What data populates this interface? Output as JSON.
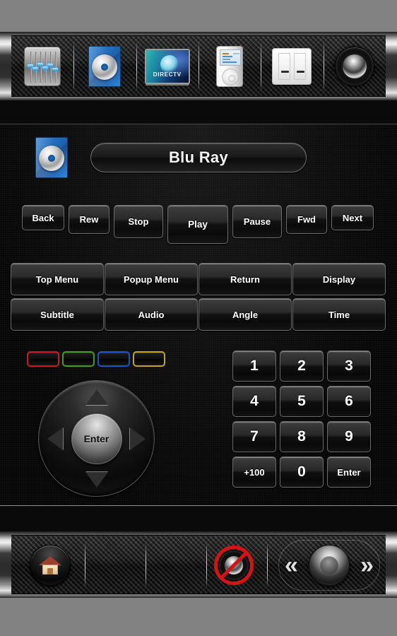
{
  "app": {
    "title": "Blu Ray",
    "background_color": "#828282"
  },
  "tabbar": {
    "items": [
      {
        "label": "Receiver",
        "icon": "equalizer-icon"
      },
      {
        "label": "Blu Ray",
        "icon": "bluray-disc-icon",
        "selected": true
      },
      {
        "label": "DIRECTV",
        "icon": "directv-tv-icon",
        "screen_text": "DIRECTV"
      },
      {
        "label": "iPod",
        "icon": "ipod-icon"
      },
      {
        "label": "Lights",
        "icon": "light-switch-icon"
      },
      {
        "label": "Speakers",
        "icon": "speaker-icon"
      }
    ]
  },
  "header": {
    "device_icon": "bluray-disc-icon",
    "device_name": "Blu Ray"
  },
  "transport": {
    "buttons": [
      {
        "label": "Back"
      },
      {
        "label": "Rew"
      },
      {
        "label": "Stop"
      },
      {
        "label": "Play"
      },
      {
        "label": "Pause"
      },
      {
        "label": "Fwd"
      },
      {
        "label": "Next"
      }
    ]
  },
  "menu": {
    "row1": [
      {
        "label": "Top Menu"
      },
      {
        "label": "Popup Menu"
      },
      {
        "label": "Return"
      },
      {
        "label": "Display"
      }
    ],
    "row2": [
      {
        "label": "Subtitle"
      },
      {
        "label": "Audio"
      },
      {
        "label": "Angle"
      },
      {
        "label": "Time"
      }
    ]
  },
  "color_buttons": [
    {
      "name": "red",
      "color": "#cc1722"
    },
    {
      "name": "green",
      "color": "#3f9e22"
    },
    {
      "name": "blue",
      "color": "#1557c8"
    },
    {
      "name": "yellow",
      "color": "#c4a41c"
    }
  ],
  "dpad": {
    "center_label": "Enter",
    "up": "Up",
    "down": "Down",
    "left": "Left",
    "right": "Right"
  },
  "keypad": {
    "keys": [
      {
        "label": "1"
      },
      {
        "label": "2"
      },
      {
        "label": "3"
      },
      {
        "label": "4"
      },
      {
        "label": "5"
      },
      {
        "label": "6"
      },
      {
        "label": "7"
      },
      {
        "label": "8"
      },
      {
        "label": "9"
      },
      {
        "label": "+100",
        "small": true
      },
      {
        "label": "0"
      },
      {
        "label": "Enter",
        "small": true
      }
    ]
  },
  "bottombar": {
    "home": {
      "label": "Home",
      "icon": "house-icon"
    },
    "mute": {
      "label": "Mute",
      "icon": "speaker-muted-icon",
      "slash_color": "#d41414"
    },
    "volume_down": {
      "label": "Volume Down",
      "glyph": "«"
    },
    "volume_speaker": {
      "label": "Volume",
      "icon": "speaker-icon"
    },
    "volume_up": {
      "label": "Volume Up",
      "glyph": "»"
    }
  }
}
